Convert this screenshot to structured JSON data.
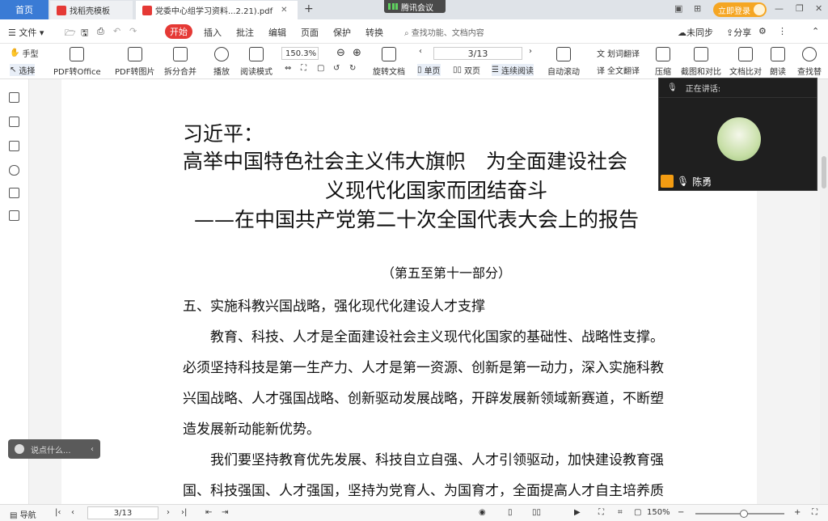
{
  "tabs": {
    "home": "首页",
    "template": "找稻壳模板",
    "document": "党委中心组学习资料...2.21).pdf"
  },
  "meeting_badge": "腾讯会议",
  "login": "立即登录",
  "menu": {
    "file": "文件",
    "start": "开始",
    "insert": "插入",
    "annotate": "批注",
    "edit": "编辑",
    "page": "页面",
    "protect": "保护",
    "convert": "转换",
    "search": "查找功能、文档内容",
    "unsynced": "未同步",
    "share": "分享"
  },
  "ribbon": {
    "hand": "手型",
    "select": "选择",
    "pdf_office": "PDF转Office",
    "pdf_image": "PDF转图片",
    "split_merge": "拆分合并",
    "play": "播放",
    "read_mode": "阅读模式",
    "zoom": "150.3%",
    "rotate": "旋转文档",
    "page_indicator": "3/13",
    "single": "单页",
    "double": "双页",
    "continuous": "连续阅读",
    "auto_scroll": "自动滚动",
    "word_translate": "划词翻译",
    "full_translate": "全文翻译",
    "compress": "压缩",
    "screenshot": "截图和对比",
    "compare": "文档比对",
    "read_aloud": "朗读",
    "find": "查找替"
  },
  "document": {
    "title1": "习近平：",
    "title2": "高举中国特色社会主义伟大旗帜　为全面建设社会",
    "title3": "义现代化国家而团结奋斗",
    "title4": "——在中国共产党第二十次全国代表大会上的报告",
    "part": "（第五至第十一部分）",
    "heading": "五、实施科教兴国战略，强化现代化建设人才支撑",
    "p1": "　　教育、科技、人才是全面建设社会主义现代化国家的基础性、战略性支撑。",
    "p2": "必须坚持科技是第一生产力、人才是第一资源、创新是第一动力，深入实施科教",
    "p3": "兴国战略、人才强国战略、创新驱动发展战略，开辟发展新领域新赛道，不断塑",
    "p4": "造发展新动能新优势。",
    "p5": "　　我们要坚持教育优先发展、科技自立自强、人才引领驱动，加快建设教育强",
    "p6": "国、科技强国、人才强国，坚持为党育人、为国育才，全面提高人才自主培养质"
  },
  "video": {
    "speaking": "正在讲话:",
    "name": "陈勇"
  },
  "chat_placeholder": "说点什么...",
  "status": {
    "nav": "导航",
    "page": "3/13",
    "zoom": "150%"
  }
}
